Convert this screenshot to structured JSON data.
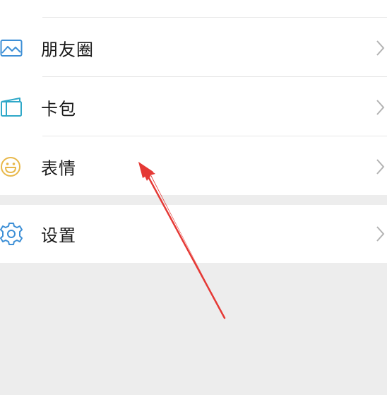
{
  "menu": {
    "items": [
      {
        "label": "朋友圈",
        "icon": "moments-icon"
      },
      {
        "label": "卡包",
        "icon": "card-wallet-icon"
      },
      {
        "label": "表情",
        "icon": "sticker-smiley-icon"
      }
    ],
    "settings": {
      "label": "设置",
      "icon": "gear-icon"
    }
  },
  "colors": {
    "icon_blue": "#3d8fd6",
    "icon_teal": "#2fa8c8",
    "icon_yellow": "#e8b84a",
    "background": "#ededed",
    "arrow_red": "#e53935"
  }
}
